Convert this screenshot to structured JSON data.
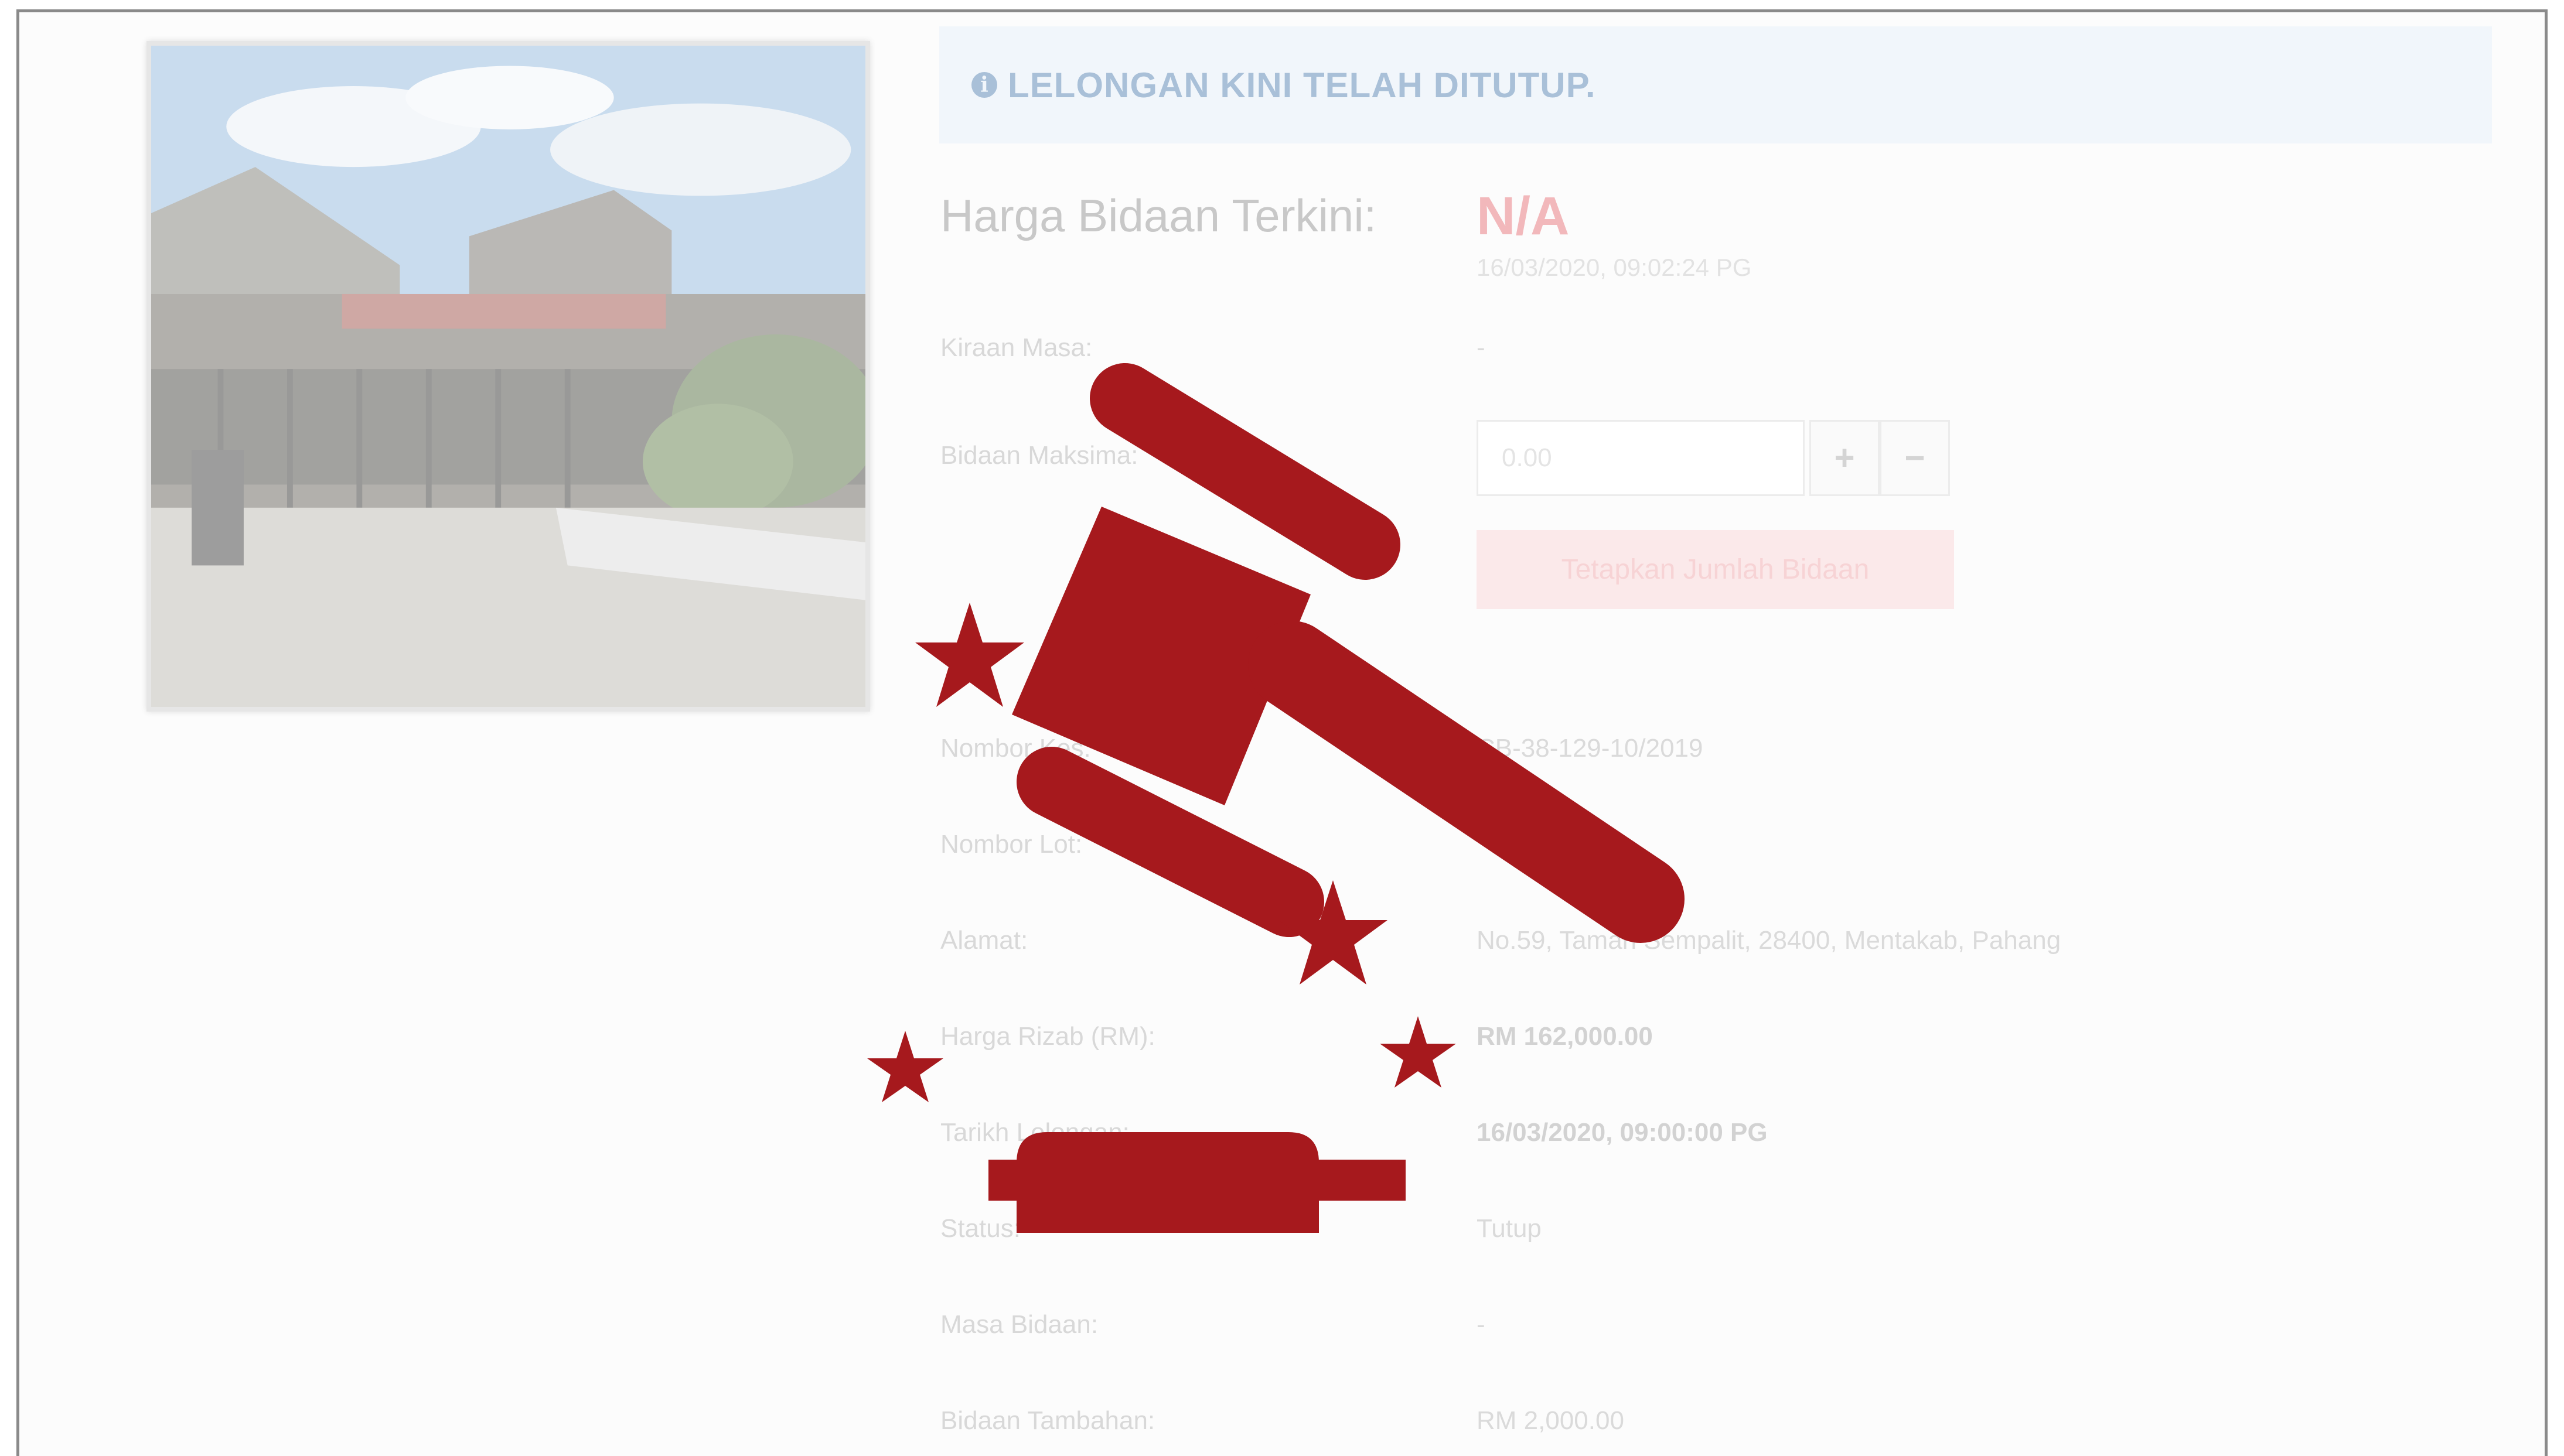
{
  "banner": {
    "icon": "info-circle-icon",
    "text": "LELONGAN KINI TELAH DITUTUP."
  },
  "current_bid": {
    "label": "Harga Bidaan Terkini:",
    "value": "N/A",
    "datetime": "16/03/2020, 09:02:24 PG"
  },
  "countdown": {
    "label": "Kiraan Masa:",
    "value": "-"
  },
  "max_bid": {
    "label": "Bidaan Maksima:",
    "input_value": "0.00",
    "plus_label": "+",
    "minus_label": "−"
  },
  "submit": {
    "label": "Tetapkan Jumlah Bidaan"
  },
  "details": {
    "case_no": {
      "label": "Nombor Kes:",
      "value": "CB-38-129-10/2019"
    },
    "lot_no": {
      "label": "Nombor Lot:",
      "value": ""
    },
    "address": {
      "label": "Alamat:",
      "value": "No.59, Taman Sempalit, 28400, Mentakab, Pahang"
    },
    "reserve_price": {
      "label": "Harga Rizab (RM):",
      "value": "RM 162,000.00"
    },
    "auction_date": {
      "label": "Tarikh Lelongan:",
      "value": "16/03/2020, 09:00:00 PG"
    },
    "status": {
      "label": "Status:",
      "value": "Tutup"
    },
    "bid_time": {
      "label": "Masa Bidaan:",
      "value": "-"
    },
    "bid_increment": {
      "label": "Bidaan Tambahan:",
      "value": "RM 2,000.00"
    }
  },
  "overlay": {
    "icon": "auction-gavel-icon",
    "color": "#a6191d"
  },
  "colors": {
    "accent": "#a6191d",
    "banner_bg": "#f1f6fb"
  }
}
